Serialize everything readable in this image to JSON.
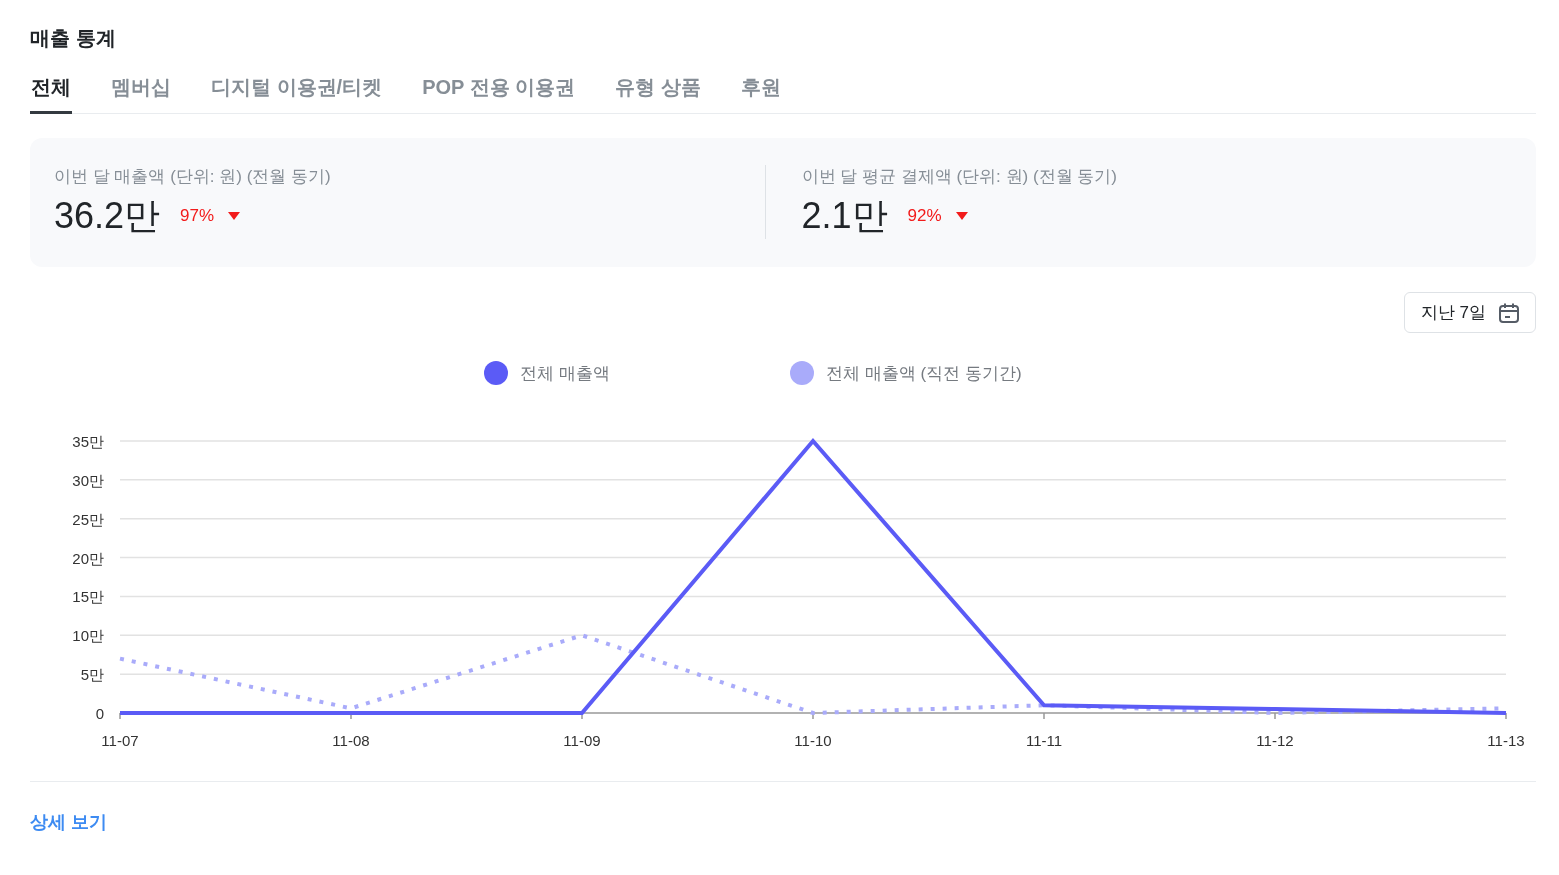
{
  "title": "매출 통계",
  "tabs": [
    {
      "label": "전체",
      "selected": true
    },
    {
      "label": "멤버십",
      "selected": false
    },
    {
      "label": "디지털 이용권/티켓",
      "selected": false
    },
    {
      "label": "POP 전용 이용권",
      "selected": false
    },
    {
      "label": "유형 상품",
      "selected": false
    },
    {
      "label": "후원",
      "selected": false
    }
  ],
  "metrics": [
    {
      "label": "이번 달 매출액 (단위: 원) (전월 동기)",
      "value": "36.2만",
      "change": "97%",
      "kind": "decrease"
    },
    {
      "label": "이번 달 평균 결제액 (단위: 원) (전월 동기)",
      "value": "2.1만",
      "change": "92%",
      "kind": "decrease"
    }
  ],
  "period_button": {
    "label": "지난 7일"
  },
  "chart": {
    "chart_data": {
      "type": "line",
      "categories": [
        "11-07",
        "11-08",
        "11-09",
        "11-10",
        "11-11",
        "11-12",
        "11-13"
      ],
      "series": [
        {
          "name": "전체 매출액",
          "color": "#5b5bf6",
          "line_style": "solid",
          "values": [
            0,
            0,
            0,
            35,
            1,
            0.5,
            0
          ]
        },
        {
          "name": "전체 매출액 (직전 동기간)",
          "color": "#a9abfa",
          "line_style": "dotted",
          "values": [
            7,
            0.6,
            10,
            0,
            1,
            0,
            0.6
          ]
        }
      ],
      "ylim": [
        0,
        35
      ],
      "grid": true,
      "yticks": [
        {
          "value": 0,
          "label": "0"
        },
        {
          "value": 5,
          "label": "5만"
        },
        {
          "value": 10,
          "label": "10만"
        },
        {
          "value": 15,
          "label": "15만"
        },
        {
          "value": 20,
          "label": "20만"
        },
        {
          "value": 25,
          "label": "25만"
        },
        {
          "value": 30,
          "label": "30만"
        },
        {
          "value": 35,
          "label": "35만"
        }
      ]
    }
  },
  "detail_link": "상세 보기"
}
